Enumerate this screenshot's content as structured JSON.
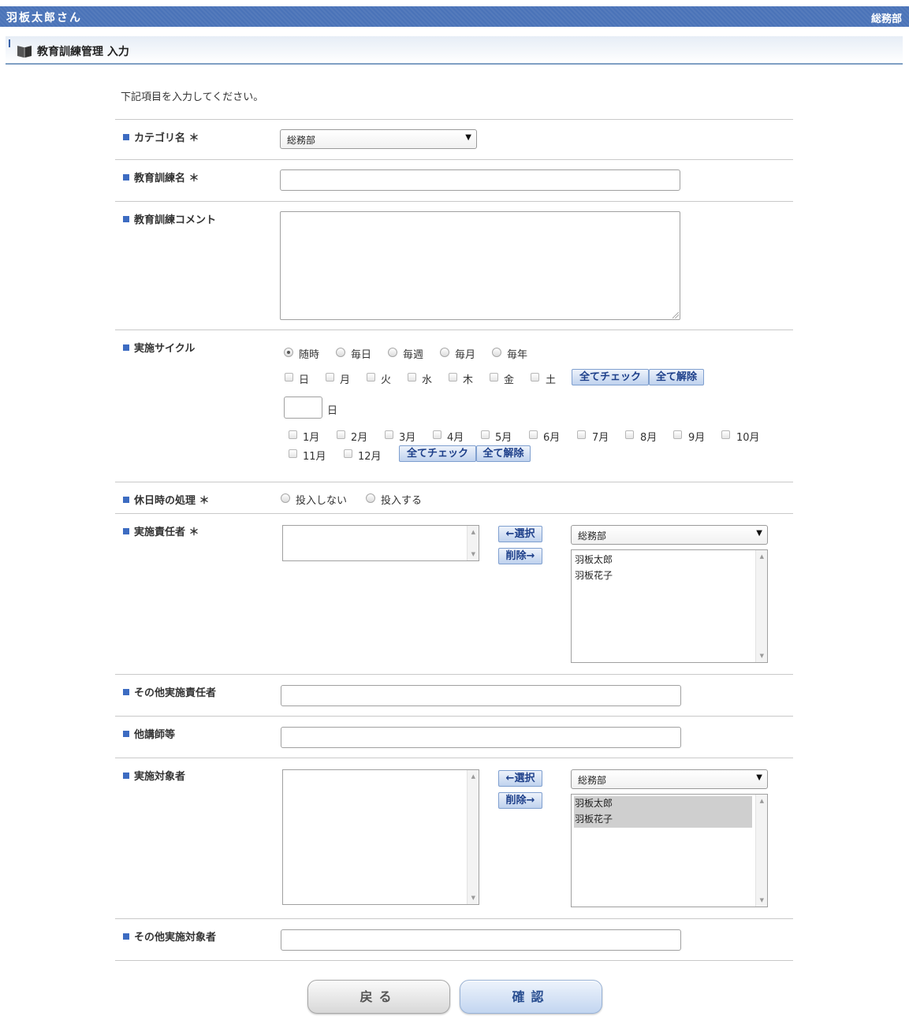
{
  "header": {
    "user": "羽板太郎さん",
    "dept": "総務部"
  },
  "page": {
    "title": "教育訓練管理 入力",
    "intro": "下記項目を入力してください。"
  },
  "form": {
    "category": {
      "label": "カテゴリ名 ＊",
      "value": "総務部"
    },
    "name": {
      "label": "教育訓練名 ＊",
      "value": ""
    },
    "comment": {
      "label": "教育訓練コメント",
      "value": ""
    },
    "cycle": {
      "label": "実施サイクル",
      "radios": [
        "随時",
        "毎日",
        "毎週",
        "毎月",
        "毎年"
      ],
      "selected": "随時",
      "weekdays": [
        "日",
        "月",
        "火",
        "水",
        "木",
        "金",
        "土"
      ],
      "day_unit": "日",
      "day_value": "",
      "months": [
        "1月",
        "2月",
        "3月",
        "4月",
        "5月",
        "6月",
        "7月",
        "8月",
        "9月",
        "10月",
        "11月",
        "12月"
      ],
      "check_all": "全てチェック",
      "clear_all": "全て解除"
    },
    "holiday": {
      "label": "休日時の処理 ＊",
      "options": [
        "投入しない",
        "投入する"
      ]
    },
    "responsible": {
      "label": "実施責任者 ＊",
      "select_btn": "←選択",
      "delete_btn": "削除→",
      "dept": "総務部",
      "candidates": [
        "羽板太郎",
        "羽板花子"
      ]
    },
    "other_responsible": {
      "label": "その他実施責任者",
      "value": ""
    },
    "instructor": {
      "label": "他講師等",
      "value": ""
    },
    "target": {
      "label": "実施対象者",
      "select_btn": "←選択",
      "delete_btn": "削除→",
      "dept": "総務部",
      "candidates": [
        "羽板太郎",
        "羽板花子"
      ]
    },
    "other_target": {
      "label": "その他実施対象者",
      "value": ""
    }
  },
  "actions": {
    "back": "戻る",
    "confirm": "確認"
  }
}
